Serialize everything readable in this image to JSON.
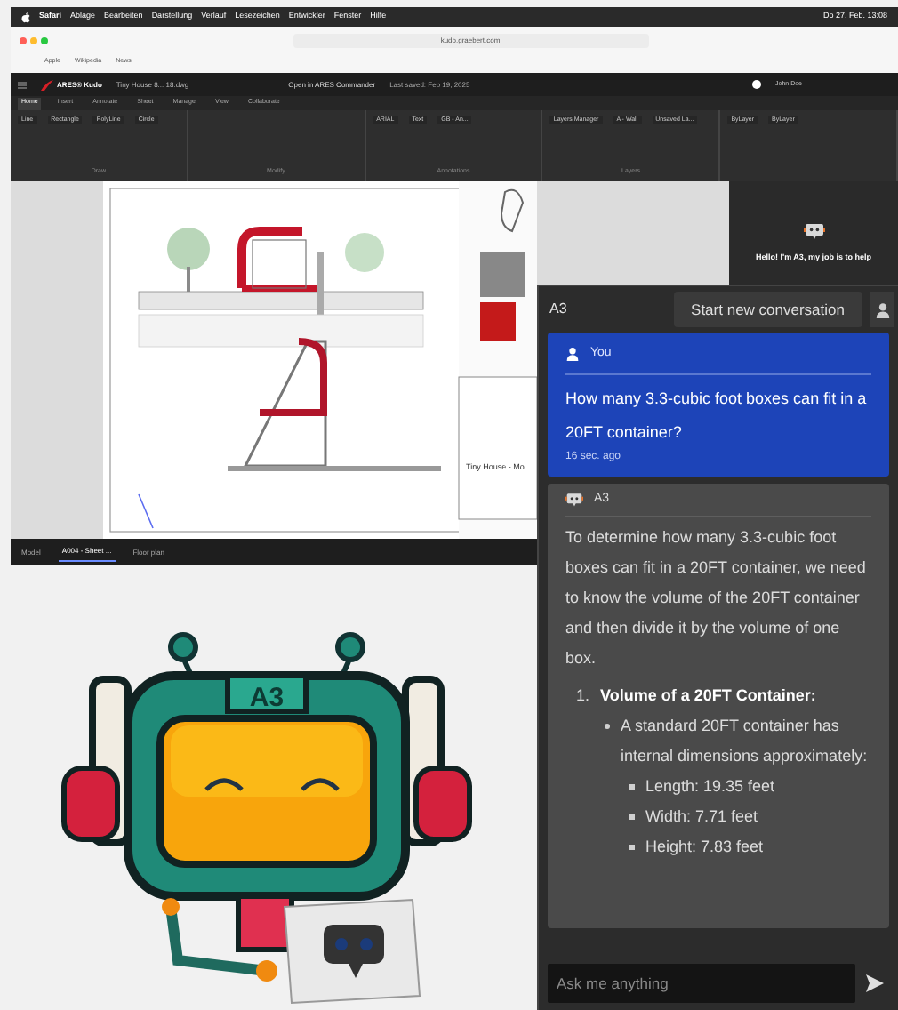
{
  "menu_bar": {
    "items": [
      "Safari",
      "Ablage",
      "Bearbeiten",
      "Darstellung",
      "Verlauf",
      "Lesezeichen",
      "Entwickler",
      "Fenster",
      "Hilfe"
    ],
    "clock": "Do 27. Feb. 13:08"
  },
  "browser": {
    "url": "kudo.graebert.com",
    "bookmarks": [
      "Apple",
      "Wikipedia",
      "News"
    ]
  },
  "app_header": {
    "product": "ARES® Kudo",
    "file": "Tiny House 8... 18.dwg",
    "open_button": "Open in ARES Commander",
    "saved": "Last saved: Feb 19, 2025",
    "user": "John Doe"
  },
  "ribbon_tabs": [
    {
      "label": "Home",
      "selected": true
    },
    {
      "label": "Insert",
      "selected": false
    },
    {
      "label": "Annotate",
      "selected": false
    },
    {
      "label": "Sheet",
      "selected": false
    },
    {
      "label": "Manage",
      "selected": false
    },
    {
      "label": "View",
      "selected": false
    },
    {
      "label": "Collaborate",
      "selected": false
    }
  ],
  "ribbon_groups": [
    {
      "label": "Draw",
      "tools": [
        "Line",
        "Rectangle",
        "PolyLine",
        "Circle"
      ]
    },
    {
      "label": "Modify"
    },
    {
      "label": "Annotations",
      "tools": [
        "ARIAL",
        "Text",
        "GB - An..."
      ]
    },
    {
      "label": "Layers",
      "tools": [
        "Layers Manager",
        "A - Wall",
        "Unsaved La..."
      ]
    },
    {
      "tools": [
        "ByLayer",
        "ByLayer"
      ]
    }
  ],
  "drawing": {
    "title_block": "Tiny House - Mo"
  },
  "side_panel": {
    "greeting": "Hello! I'm A3, my job is to help"
  },
  "layout_tabs": [
    {
      "label": "Model",
      "selected": false
    },
    {
      "label": "A004 - Sheet ...",
      "selected": true
    },
    {
      "label": "Floor plan",
      "selected": false
    }
  ],
  "chat": {
    "title": "A3",
    "new_button": "Start new conversation",
    "messages": [
      {
        "kind": "user",
        "author": "You",
        "text": "How many 3.3-cubic foot boxes can fit in a 20FT container?",
        "time": "16 sec. ago"
      },
      {
        "kind": "assistant",
        "author": "A3",
        "text": "To determine how many 3.3-cubic foot boxes can fit in a 20FT container, we need to know the volume of the 20FT container and then divide it by the volume of one box.",
        "list": [
          {
            "marker": "1.",
            "title": "Volume of a 20FT Container:",
            "bullets": [
              {
                "text": "A standard 20FT container has internal dimensions approximately:",
                "children": [
                  {
                    "text": "Length: 19.35 feet"
                  },
                  {
                    "text": "Width: 7.71 feet"
                  },
                  {
                    "text": "Height: 7.83 feet"
                  }
                ]
              }
            ]
          }
        ]
      }
    ],
    "input": {
      "placeholder": "Ask me anything"
    }
  },
  "mascot": {
    "label": "A3"
  }
}
